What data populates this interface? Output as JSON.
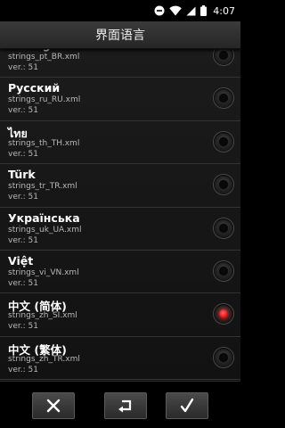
{
  "status_bar": {
    "time": "4:07",
    "icons": [
      "do-not-disturb-icon",
      "wifi-icon",
      "cell-signal-icon",
      "battery-icon"
    ]
  },
  "title": "界面语言",
  "languages": [
    {
      "name": "Português",
      "file": "strings_pt_BR.xml",
      "version": "ver.: 51",
      "selected": false
    },
    {
      "name": "Русский",
      "file": "strings_ru_RU.xml",
      "version": "ver.: 51",
      "selected": false
    },
    {
      "name": "ไทย",
      "file": "strings_th_TH.xml",
      "version": "ver.: 51",
      "selected": false
    },
    {
      "name": "Türk",
      "file": "strings_tr_TR.xml",
      "version": "ver.: 51",
      "selected": false
    },
    {
      "name": "Українська",
      "file": "strings_uk_UA.xml",
      "version": "ver.: 51",
      "selected": false
    },
    {
      "name": "Việt",
      "file": "strings_vi_VN.xml",
      "version": "ver.: 51",
      "selected": false
    },
    {
      "name": "中文 (简体)",
      "file": "strings_zh_SI.xml",
      "version": "ver.: 51",
      "selected": true
    },
    {
      "name": "中文 (繁体)",
      "file": "strings_zh_TR.xml",
      "version": "ver.: 51",
      "selected": false
    }
  ],
  "colors": {
    "selected_radio": "#e00000",
    "title_bar": "#303030",
    "background": "#000000"
  },
  "bottom_bar": {
    "buttons": [
      "close-icon",
      "undo-icon",
      "check-icon"
    ]
  }
}
